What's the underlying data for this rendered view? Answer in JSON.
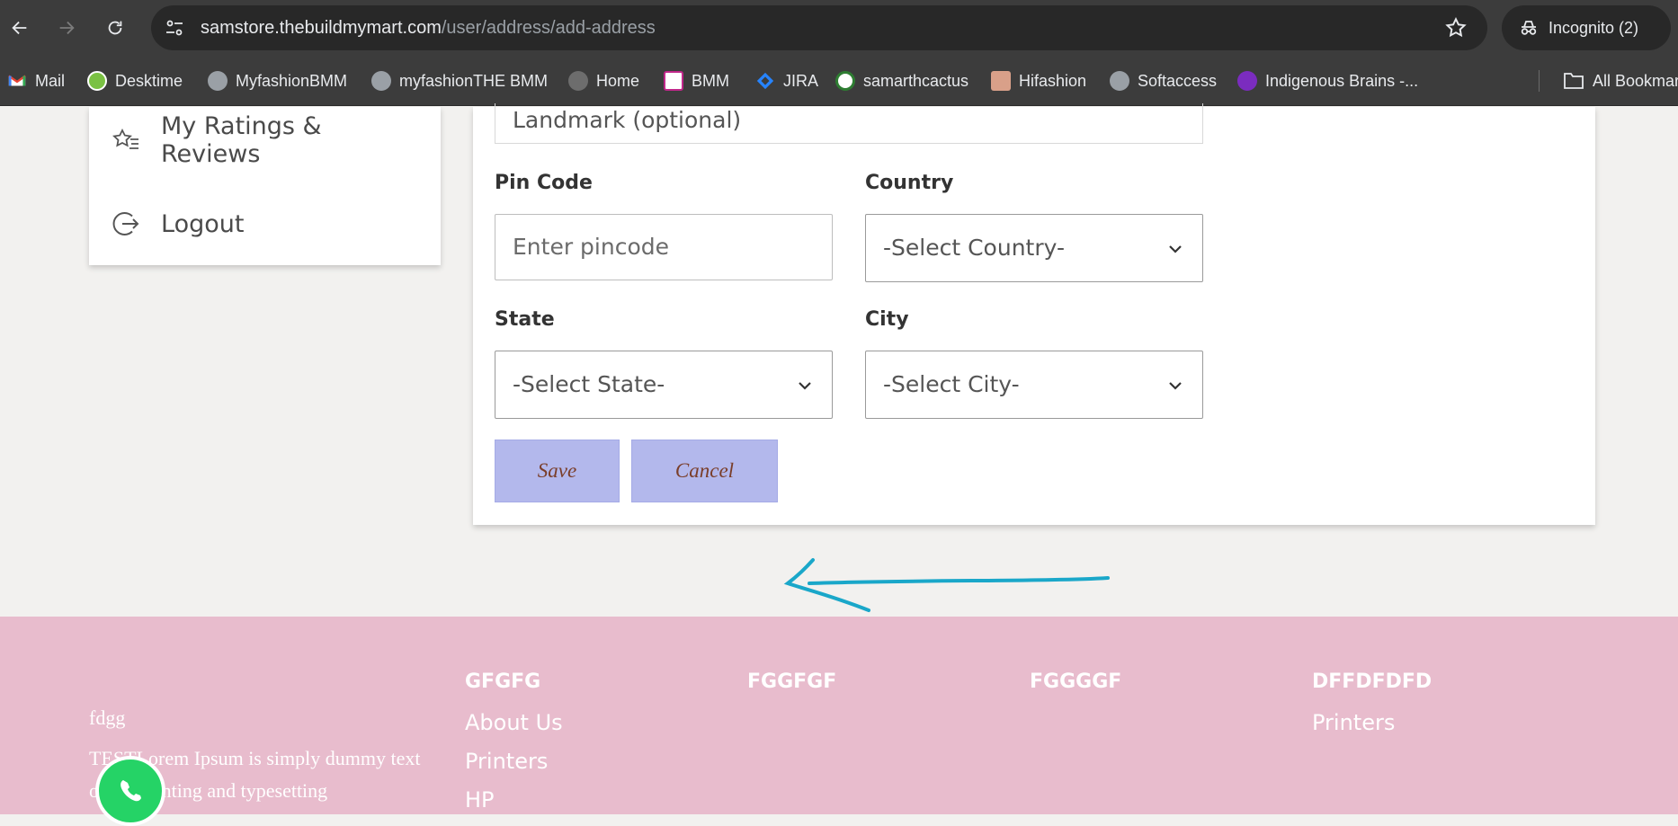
{
  "browser": {
    "url_host": "samstore.thebuildmymart.com",
    "url_path": "/user/address/add-address",
    "incognito_label": "Incognito (2)",
    "bookmarks": [
      {
        "label": "Mail",
        "icon": "gmail-icon"
      },
      {
        "label": "Desktime",
        "icon": "desktime-icon"
      },
      {
        "label": "MyfashionBMM",
        "icon": "globe-icon"
      },
      {
        "label": "myfashionTHE BMM",
        "icon": "globe-icon"
      },
      {
        "label": "Home",
        "icon": "globe-icon"
      },
      {
        "label": "BMM",
        "icon": "bmm-icon"
      },
      {
        "label": "JIRA",
        "icon": "jira-icon"
      },
      {
        "label": "samarthcactus",
        "icon": "cactus-icon"
      },
      {
        "label": "Hifashion",
        "icon": "hifashion-icon"
      },
      {
        "label": "Softaccess",
        "icon": "globe-icon"
      },
      {
        "label": "Indigenous Brains -...",
        "icon": "indigenous-icon"
      }
    ],
    "all_bookmarks_label": "All Bookmarks"
  },
  "sidebar": {
    "items": [
      {
        "label": "My Ratings & Reviews",
        "icon": "star-list-icon"
      },
      {
        "label": "Logout",
        "icon": "logout-icon"
      }
    ]
  },
  "form": {
    "landmark_placeholder": "Landmark (optional)",
    "pincode_label": "Pin Code",
    "pincode_placeholder": "Enter pincode",
    "country_label": "Country",
    "country_value": "-Select Country-",
    "state_label": "State",
    "state_value": "-Select State-",
    "city_label": "City",
    "city_value": "-Select City-",
    "save_label": "Save",
    "cancel_label": "Cancel"
  },
  "footer": {
    "brand": "fdgg",
    "description": "TESTLorem Ipsum is simply dummy text of the printing and typesetting",
    "columns": [
      {
        "heading": "GFGFG",
        "links": [
          "About Us",
          "Printers",
          "HP"
        ]
      },
      {
        "heading": "FGGFGF",
        "links": []
      },
      {
        "heading": "FGGGGF",
        "links": []
      },
      {
        "heading": "DFFDFDFD",
        "links": [
          "Printers"
        ]
      }
    ]
  },
  "colors": {
    "chrome_bg": "#3c3c3c",
    "button_bg": "#b3b8ec",
    "footer_bg": "#e8bccd",
    "annotation_arrow": "#1aa7c9",
    "whatsapp": "#25d366"
  }
}
